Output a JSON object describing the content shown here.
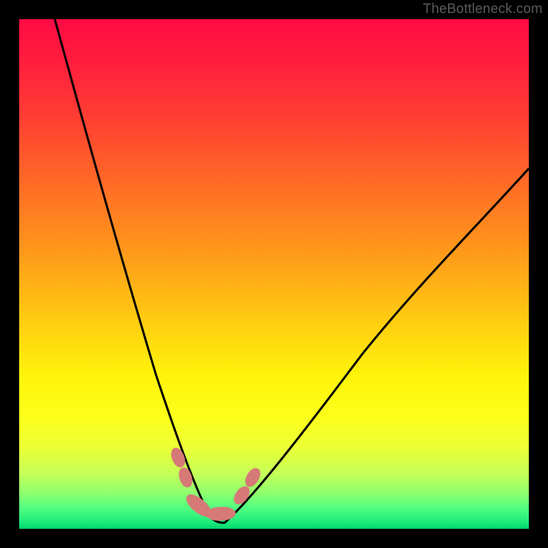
{
  "watermark": "TheBottleneck.com",
  "colors": {
    "background": "#000000",
    "curve_stroke": "#000000",
    "bead_fill": "#d67a77",
    "watermark_text": "#5a5a5a"
  },
  "chart_data": {
    "type": "line",
    "title": "",
    "xlabel": "",
    "ylabel": "",
    "xlim": [
      0,
      100
    ],
    "ylim": [
      0,
      100
    ],
    "grid": false,
    "legend": false,
    "note": "V-shaped bottleneck curve on red→green vertical gradient; minimum sits near x≈37, y≈2. Values are estimated from pixel positions (no axis ticks present).",
    "series": [
      {
        "name": "left-branch",
        "x": [
          7,
          10,
          14,
          18,
          22,
          26,
          29,
          31,
          33,
          35,
          37
        ],
        "y": [
          100,
          88,
          73,
          58,
          44,
          31,
          21,
          14,
          9,
          5,
          2
        ]
      },
      {
        "name": "right-branch",
        "x": [
          37,
          40,
          44,
          50,
          57,
          65,
          74,
          84,
          94,
          100
        ],
        "y": [
          2,
          4,
          8,
          14,
          22,
          32,
          43,
          54,
          65,
          71
        ]
      }
    ],
    "marker_cluster": {
      "description": "salmon rounded bead chain along the curve trough",
      "approx_points": [
        {
          "x": 31,
          "y": 14
        },
        {
          "x": 32,
          "y": 10
        },
        {
          "x": 33.5,
          "y": 6
        },
        {
          "x": 35.5,
          "y": 3
        },
        {
          "x": 38,
          "y": 2.5
        },
        {
          "x": 40.5,
          "y": 3.5
        },
        {
          "x": 42.5,
          "y": 6
        },
        {
          "x": 44,
          "y": 9
        }
      ]
    },
    "gradient_stops": [
      {
        "pos": 0.0,
        "color": "#ff0b44"
      },
      {
        "pos": 0.18,
        "color": "#ff3a34"
      },
      {
        "pos": 0.46,
        "color": "#ff9a1a"
      },
      {
        "pos": 0.7,
        "color": "#fff40a"
      },
      {
        "pos": 0.89,
        "color": "#c6ff56"
      },
      {
        "pos": 1.0,
        "color": "#00d36a"
      }
    ]
  }
}
